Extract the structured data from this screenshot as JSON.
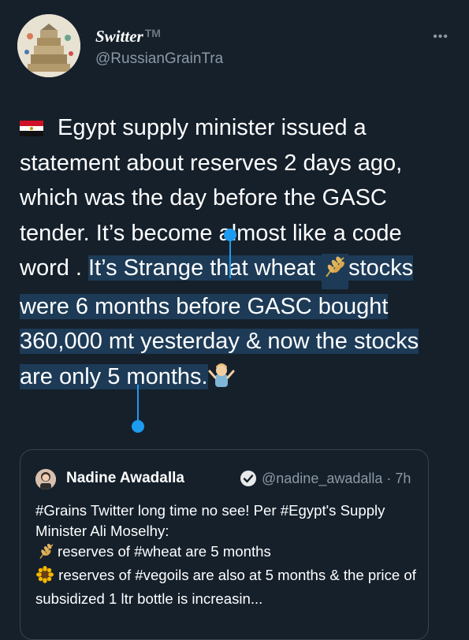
{
  "tweet": {
    "display_name": "Switter",
    "trademark": "TM",
    "handle": "@RussianGrainTra",
    "more_label": "•••",
    "text_plain": "Egypt supply minister  issued a statement about reserves 2 days ago, which was the day before the GASC tender. It’s become almost like a code word . ",
    "text_selected_1": "It’s Strange that wheat ",
    "text_selected_2": "stocks were 6 months before GASC  bought 360,000 mt yesterday & now the stocks are only 5 months."
  },
  "quote": {
    "name": "Nadine Awadalla",
    "handle": "@nadine_awadalla · 7h",
    "line1": "#Grains Twitter long time no see! Per #Egypt's Supply Minister Ali Moselhy:",
    "line2": "reserves of #wheat are 5 months",
    "line3": " reserves of #vegoils are also at 5 months & the price of subsidized 1 ltr bottle is increasin..."
  },
  "icons": {
    "flag": "egypt-flag-icon",
    "wheat": "wheat-icon",
    "shrug": "person-shrugging-icon",
    "verified": "verified-badge-icon",
    "sunflower": "sunflower-icon"
  }
}
